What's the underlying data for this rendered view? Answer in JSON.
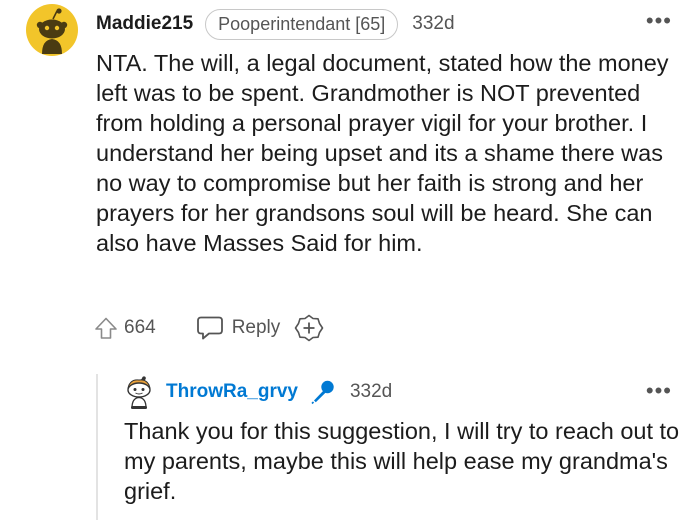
{
  "comment": {
    "username": "Maddie215",
    "flair": "Pooperintendant [65]",
    "age": "332d",
    "more": "•••",
    "body": "NTA. The will, a legal document, stated how the money left was to be spent. Grandmother is NOT prevented from holding a personal prayer vigil for your brother. I understand her being upset and its a shame there was no way to compromise but her faith is strong and her prayers for her grandsons soul will be heard. She can also have Masses Said for him.",
    "upvotes": "664",
    "reply_label": "Reply",
    "icons": {
      "avatar": "snoo-avatar-icon",
      "upvote": "upvote-arrow-icon",
      "reply": "speech-bubble-icon",
      "award": "add-award-icon"
    }
  },
  "reply": {
    "username": "ThrowRa_grvy",
    "age": "332d",
    "more": "•••",
    "body": "Thank you for this suggestion, I will try to reach out to my parents, maybe this will help ease my grandma's grief.",
    "icons": {
      "avatar": "snoo-avatar-icon",
      "op_badge": "microphone-icon"
    }
  },
  "colors": {
    "avatar_bg": "#f2c52a",
    "op_username": "#0079d3",
    "text": "#1c1c1c",
    "meta": "#555555"
  }
}
